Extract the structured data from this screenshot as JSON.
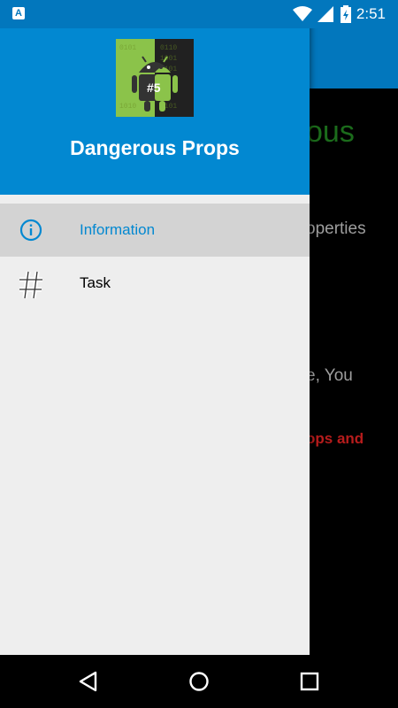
{
  "status_bar": {
    "notification_icon": "A",
    "time": "2:51",
    "icons": [
      "wifi-icon",
      "signal-icon",
      "battery-charging-icon"
    ]
  },
  "background_app": {
    "heading_fragment": "ous",
    "text_fragment_1": "operties",
    "text_fragment_2": "e, You",
    "text_fragment_3": "ops and"
  },
  "drawer": {
    "title": "Dangerous Props",
    "logo_badge": "#5",
    "items": [
      {
        "label": "Information",
        "icon": "info-icon",
        "selected": true
      },
      {
        "label": "Task",
        "icon": "hash-icon",
        "selected": false
      }
    ]
  },
  "navigation_bar": {
    "buttons": [
      "back-icon",
      "home-icon",
      "recents-icon"
    ]
  },
  "colors": {
    "primary_dark": "#0277BD",
    "primary": "#0288D1",
    "drawer_bg": "#EEEEEE",
    "selected_item_bg": "#D3D3D3",
    "heading_green": "#1b6b1b",
    "warning_red": "#b71c1c"
  }
}
